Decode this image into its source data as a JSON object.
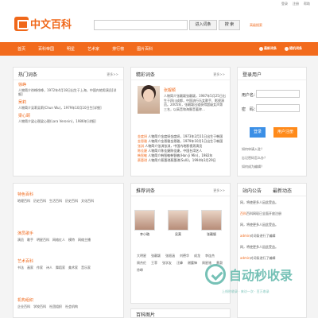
{
  "top_links": [
    "登录",
    "注册",
    "帮助"
  ],
  "logo": "中文百科",
  "search": {
    "placeholder": "",
    "btn_enter": "进入词条",
    "btn_search": "搜 索",
    "advanced": "高级搜索"
  },
  "nav": {
    "items": [
      "首页",
      "百科帝国",
      "明星",
      "艺术家",
      "排行榜",
      "图片百科"
    ],
    "right": [
      "最新词条",
      "随机词条"
    ]
  },
  "hot": {
    "title": "热门词条",
    "more": "更多>>",
    "items": [
      {
        "name": "徐峥",
        "desc": "人物简介徐峥徐峥，1972年4月18日出生于上海，中国内地男演员[详细]"
      },
      {
        "name": "吴莉",
        "desc": "人物简介吴莉吴莉(Chun Wu)，1979年10月10日生[详细]"
      },
      {
        "name": "梁心颐",
        "desc": "人物简介梁心颐梁心颐(Lara Veronin)，1986年[详细]"
      }
    ]
  },
  "featured": {
    "title": "精彩词条",
    "more": "更多>>",
    "name": "张靓颖",
    "desc": "人物简介张靓颖张靓颖，1987年5月25日出生于四川成都，中国流行乐女歌手、影视演员。2005年，张靓颖出道获得超级女声第三名，以高音和海豚音著称…",
    "list": [
      {
        "name": "金度妍",
        "desc": "人物简介金度妍金度妍，1973年2月11日出生于韩国"
      },
      {
        "name": "金恩雅",
        "desc": "人物简介金恩雅金恩雅，1979年10月1日出生于韩国"
      },
      {
        "name": "张淇",
        "desc": "人物简介张淇张淇，中国内地影视男演员"
      },
      {
        "name": "陈佳婕",
        "desc": "人物简介陈佳婕陈佳婕，中国台湾艺人"
      },
      {
        "name": "韩智敏",
        "desc": "人物简介韩智敏韩智敏(Han Ji Min)，1982年"
      },
      {
        "name": "蔡蕙琪",
        "desc": "人物简介蔡蕙琪蔡蕙琪(Sulli)，1994年3月29日"
      }
    ]
  },
  "login": {
    "title": "登录用户",
    "user_label": "用户名：",
    "pass_label": "密　码：",
    "login_btn": "登录",
    "register_btn": "用户注册",
    "links": [
      "如何申请入驻？",
      "忘记密码怎么办？",
      "如何成为编辑？"
    ]
  },
  "categories": [
    {
      "title": "特色百科",
      "tags": [
        "地理百科",
        "历史百科",
        "生活百科",
        "历史百科",
        "文化百科"
      ]
    },
    {
      "title": "演员歌手",
      "tags": [
        "演员",
        "歌手",
        "明星百科",
        "网络红人",
        "模特",
        "网络主播"
      ]
    },
    {
      "title": "艺术百科",
      "tags": [
        "书法",
        "画家",
        "作家",
        "诗人",
        "舞蹈家",
        "美术家",
        "音乐家"
      ]
    },
    {
      "title": "机构组织",
      "tags": [
        "企业百科",
        "学校百科",
        "社团组织",
        "社会机构"
      ]
    }
  ],
  "recommend": {
    "title": "推荐词条",
    "more": "更多>>",
    "people": [
      "李小璐",
      "吴莫",
      "张靓颖"
    ],
    "tags": [
      "大明星",
      "张靓颖",
      "张韶涵",
      "刘德华",
      "成龙",
      "李连杰",
      "周杰伦",
      "王菲",
      "张学友",
      "汪峰",
      "谢霆锋",
      "周星驰",
      "黄渤",
      "徐峥"
    ]
  },
  "notice": {
    "title": "站内公告",
    "title2": "最新动态",
    "more": "更多>>",
    "items": [
      {
        "user": "",
        "text": "网，将使更多人因此受益。"
      },
      {
        "user": "百科",
        "text": "百科网现已全面开放注册"
      },
      {
        "user": "",
        "text": "网，将使更多人因此受益。"
      },
      {
        "user": "admin",
        "text": "对词条进行了编辑"
      },
      {
        "user": "",
        "text": "网，将使更多人因此受益。"
      },
      {
        "user": "admin",
        "text": "对词条进行了编辑"
      }
    ]
  },
  "bottom": {
    "title": "百科图片"
  },
  "watermark": {
    "text": "自动秒收录",
    "sub": "上线秒收录 · 来访一次 · 百万收录"
  }
}
